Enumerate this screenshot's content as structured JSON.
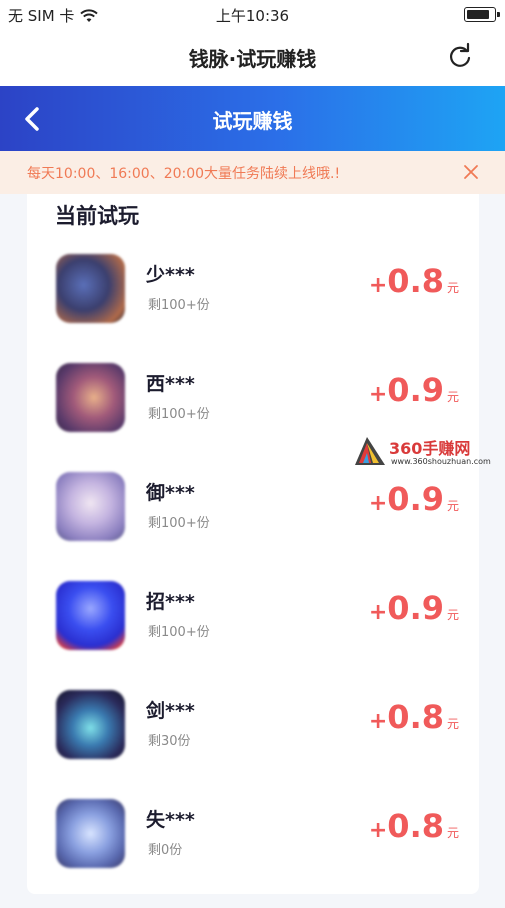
{
  "status": {
    "carrier": "无 SIM 卡",
    "time": "上午10:36"
  },
  "nav": {
    "title": "钱脉·试玩赚钱"
  },
  "header": {
    "title": "试玩赚钱"
  },
  "notice": {
    "text": "每天10:00、16:00、20:00大量任务陆续上线哦.!"
  },
  "section": {
    "title": "当前试玩"
  },
  "reward_unit": "元",
  "tasks": [
    {
      "name": "少",
      "mask": "***",
      "remain": "剩100+份",
      "sign": "+",
      "amount": "0.8"
    },
    {
      "name": "西",
      "mask": "***",
      "remain": "剩100+份",
      "sign": "+",
      "amount": "0.9"
    },
    {
      "name": "御",
      "mask": "***",
      "remain": "剩100+份",
      "sign": "+",
      "amount": "0.9"
    },
    {
      "name": "招",
      "mask": "***",
      "remain": "剩100+份",
      "sign": "+",
      "amount": "0.9"
    },
    {
      "name": "剑",
      "mask": "***",
      "remain": "剩30份",
      "sign": "+",
      "amount": "0.8"
    },
    {
      "name": "失",
      "mask": "***",
      "remain": "剩0份",
      "sign": "+",
      "amount": "0.8"
    }
  ],
  "watermark": {
    "brand": "360手赚网",
    "url": "www.360shouzhuan.com"
  },
  "colors": {
    "accent_red": "#f05a5a",
    "header_blue": "#2b6fe8",
    "notice_orange": "#f07a55"
  }
}
